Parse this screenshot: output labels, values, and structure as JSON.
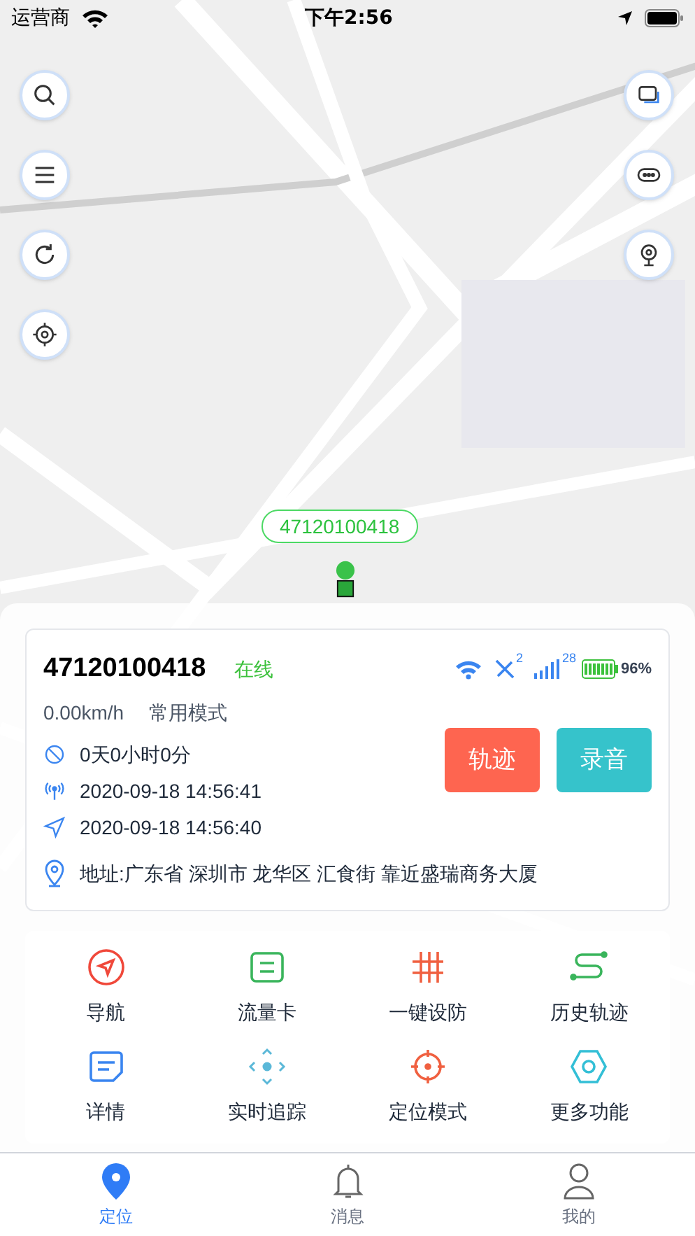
{
  "status_bar": {
    "carrier": "运营商",
    "time": "下午2:56"
  },
  "map": {
    "marker_label": "47120100418"
  },
  "device": {
    "id": "47120100418",
    "status": "在线",
    "satellites": "2",
    "signal": "28",
    "battery": "96%",
    "speed": "0.00km/h",
    "mode": "常用模式",
    "rows": [
      {
        "kind": "duration",
        "text": "0天0小时0分"
      },
      {
        "kind": "signal_time",
        "text": "2020-09-18 14:56:41"
      },
      {
        "kind": "gps_time",
        "text": "2020-09-18 14:56:40"
      }
    ],
    "address": "地址:广东省 深圳市 龙华区 汇食街 靠近盛瑞商务大厦"
  },
  "buttons": [
    {
      "kind": "track",
      "label": "轨迹"
    },
    {
      "kind": "record",
      "label": "录音"
    }
  ],
  "actions": [
    {
      "kind": "navigate",
      "label": "导航"
    },
    {
      "kind": "sim",
      "label": "流量卡"
    },
    {
      "kind": "arm",
      "label": "一键设防"
    },
    {
      "kind": "history",
      "label": "历史轨迹"
    },
    {
      "kind": "details",
      "label": "详情"
    },
    {
      "kind": "tracking",
      "label": "实时追踪"
    },
    {
      "kind": "locmode",
      "label": "定位模式"
    },
    {
      "kind": "more",
      "label": "更多功能"
    }
  ],
  "tabs": [
    {
      "kind": "location",
      "label": "定位",
      "selected": true
    },
    {
      "kind": "messages",
      "label": "消息",
      "selected": false
    },
    {
      "kind": "profile",
      "label": "我的",
      "selected": false
    }
  ]
}
